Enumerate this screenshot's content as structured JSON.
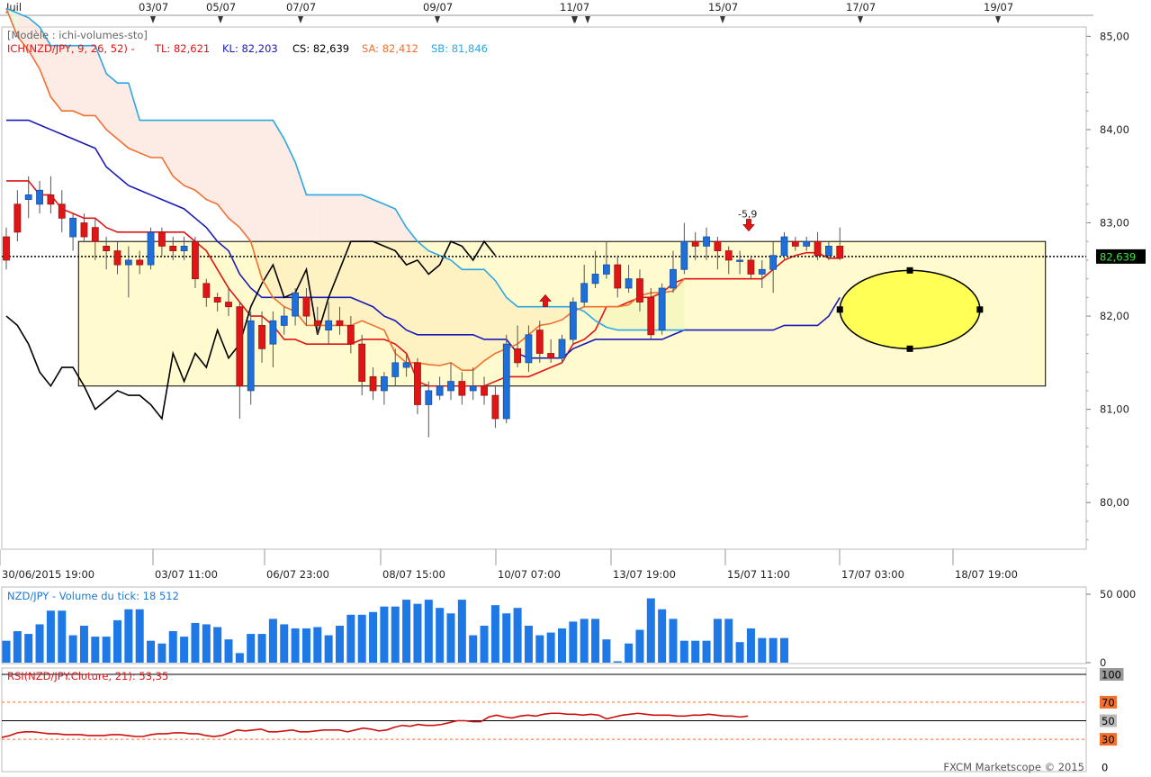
{
  "chart_data": [
    {
      "type": "candlestick",
      "symbol": "NZD/JPY",
      "template_label": "[Modèle : ichi-volumes-sto]",
      "indicator_label": "ICH(NZD/JPY, 9, 26, 52) -",
      "legend": [
        {
          "key": "tl",
          "text": "TL: 82,621",
          "color": "#e01515"
        },
        {
          "key": "kl",
          "text": "KL: 82,203",
          "color": "#1a1ab8"
        },
        {
          "key": "cs",
          "text": "CS: 82,639",
          "color": "#000000"
        },
        {
          "key": "sa",
          "text": "SA: 82,412",
          "color": "#f07030"
        },
        {
          "key": "sb",
          "text": "SB: 81,846",
          "color": "#2aa7e6"
        }
      ],
      "ylim": [
        79.5,
        85.1
      ],
      "y_ticks": [
        "85,00",
        "84,00",
        "83,00",
        "82,00",
        "81,00",
        "80,00"
      ],
      "y_tick_values": [
        85,
        84,
        83,
        82,
        81,
        80
      ],
      "top_dates": [
        "Juil",
        "03/07",
        "05/07",
        "07/07",
        "09/07",
        "11/07",
        "15/07",
        "17/07",
        "19/07"
      ],
      "bottom_dates": [
        "30/06/2015 19:00",
        "03/07 11:00",
        "06/07 23:00",
        "08/07 15:00",
        "10/07 07:00",
        "13/07 19:00",
        "15/07 11:00",
        "17/07 03:00",
        "18/07 19:00"
      ],
      "current_price": 82.639,
      "current_price_label": "82,639",
      "annotation": "-5,9",
      "candles": [
        [
          82.85,
          82.6,
          82.95,
          82.5
        ],
        [
          83.2,
          82.9,
          83.35,
          82.8
        ],
        [
          83.25,
          83.3,
          83.5,
          83.05
        ],
        [
          83.2,
          83.35,
          83.45,
          83.1
        ],
        [
          83.3,
          83.2,
          83.5,
          83.1
        ],
        [
          83.2,
          83.05,
          83.35,
          82.9
        ],
        [
          82.85,
          83.05,
          83.1,
          82.7
        ],
        [
          83.0,
          82.85,
          83.1,
          82.8
        ],
        [
          82.95,
          82.8,
          83.05,
          82.6
        ],
        [
          82.75,
          82.7,
          82.85,
          82.5
        ],
        [
          82.7,
          82.55,
          82.8,
          82.45
        ],
        [
          82.55,
          82.6,
          82.75,
          82.2
        ],
        [
          82.6,
          82.55,
          82.7,
          82.45
        ],
        [
          82.55,
          82.9,
          82.95,
          82.5
        ],
        [
          82.9,
          82.75,
          82.95,
          82.65
        ],
        [
          82.75,
          82.7,
          82.85,
          82.6
        ],
        [
          82.7,
          82.75,
          82.85,
          82.6
        ],
        [
          82.8,
          82.4,
          82.85,
          82.3
        ],
        [
          82.35,
          82.2,
          82.4,
          82.1
        ],
        [
          82.2,
          82.15,
          82.25,
          82.05
        ],
        [
          82.15,
          82.1,
          82.3,
          82.0
        ],
        [
          82.1,
          81.25,
          82.15,
          80.9
        ],
        [
          81.2,
          81.95,
          82.05,
          81.05
        ],
        [
          81.9,
          81.65,
          82.05,
          81.5
        ],
        [
          81.7,
          81.95,
          82.05,
          81.45
        ],
        [
          81.9,
          82.0,
          82.1,
          81.8
        ],
        [
          82.0,
          82.25,
          82.3,
          81.9
        ],
        [
          82.2,
          82.0,
          82.3,
          81.9
        ],
        [
          81.95,
          81.9,
          82.1,
          81.8
        ],
        [
          81.85,
          81.95,
          82.15,
          81.7
        ],
        [
          81.95,
          81.9,
          82.1,
          81.8
        ],
        [
          81.9,
          81.7,
          82.0,
          81.6
        ],
        [
          81.7,
          81.3,
          81.8,
          81.15
        ],
        [
          81.35,
          81.2,
          81.45,
          81.1
        ],
        [
          81.2,
          81.35,
          81.4,
          81.05
        ],
        [
          81.35,
          81.5,
          81.65,
          81.25
        ],
        [
          81.45,
          81.5,
          81.6,
          81.35
        ],
        [
          81.5,
          81.05,
          81.55,
          80.95
        ],
        [
          81.05,
          81.2,
          81.3,
          80.7
        ],
        [
          81.15,
          81.25,
          81.35,
          81.1
        ],
        [
          81.2,
          81.3,
          81.5,
          81.1
        ],
        [
          81.3,
          81.15,
          81.4,
          81.05
        ],
        [
          81.2,
          81.25,
          81.45,
          81.1
        ],
        [
          81.25,
          81.15,
          81.35,
          81.05
        ],
        [
          81.15,
          80.9,
          81.25,
          80.8
        ],
        [
          80.9,
          81.7,
          81.8,
          80.85
        ],
        [
          81.65,
          81.5,
          81.9,
          81.45
        ],
        [
          81.5,
          81.8,
          81.9,
          81.4
        ],
        [
          81.85,
          81.6,
          81.95,
          81.5
        ],
        [
          81.6,
          81.55,
          81.75,
          81.5
        ],
        [
          81.55,
          81.75,
          81.8,
          81.5
        ],
        [
          81.75,
          82.15,
          82.2,
          81.7
        ],
        [
          82.15,
          82.35,
          82.55,
          82.1
        ],
        [
          82.35,
          82.45,
          82.7,
          82.3
        ],
        [
          82.45,
          82.55,
          82.8,
          82.4
        ],
        [
          82.55,
          82.3,
          82.65,
          82.2
        ],
        [
          82.3,
          82.4,
          82.55,
          82.25
        ],
        [
          82.4,
          82.15,
          82.5,
          82.05
        ],
        [
          82.2,
          81.8,
          82.3,
          81.75
        ],
        [
          81.85,
          82.3,
          82.35,
          81.8
        ],
        [
          82.3,
          82.5,
          82.7,
          82.25
        ],
        [
          82.5,
          82.8,
          83.0,
          82.45
        ],
        [
          82.8,
          82.75,
          82.9,
          82.6
        ],
        [
          82.75,
          82.85,
          82.95,
          82.6
        ],
        [
          82.8,
          82.7,
          82.85,
          82.5
        ],
        [
          82.7,
          82.6,
          82.75,
          82.45
        ],
        [
          82.6,
          82.6,
          82.7,
          82.45
        ],
        [
          82.6,
          82.45,
          82.65,
          82.4
        ],
        [
          82.45,
          82.5,
          82.6,
          82.3
        ],
        [
          82.5,
          82.65,
          82.8,
          82.25
        ],
        [
          82.65,
          82.85,
          82.9,
          82.6
        ],
        [
          82.8,
          82.75,
          82.85,
          82.7
        ],
        [
          82.75,
          82.8,
          82.85,
          82.7
        ],
        [
          82.8,
          82.65,
          82.9,
          82.6
        ],
        [
          82.65,
          82.75,
          82.8,
          82.6
        ],
        [
          82.75,
          82.62,
          82.95,
          82.6
        ]
      ],
      "series": [
        {
          "key": "tl",
          "color": "#e01515",
          "values": [
            83.45,
            83.45,
            83.45,
            83.3,
            83.3,
            83.15,
            83.1,
            83.05,
            83.05,
            82.95,
            82.9,
            82.9,
            82.9,
            82.9,
            82.9,
            82.9,
            82.9,
            82.8,
            82.7,
            82.5,
            82.3,
            82.15,
            82.0,
            82.0,
            81.9,
            81.75,
            81.75,
            81.7,
            81.7,
            81.7,
            81.7,
            81.7,
            81.75,
            81.75,
            81.75,
            81.7,
            81.6,
            81.3,
            81.25,
            81.25,
            81.25,
            81.25,
            81.25,
            81.25,
            81.3,
            81.35,
            81.35,
            81.35,
            81.4,
            81.45,
            81.5,
            81.7,
            81.75,
            81.85,
            82.1,
            82.1,
            82.15,
            82.2,
            82.2,
            82.25,
            82.35,
            82.4,
            82.4,
            82.4,
            82.4,
            82.4,
            82.4,
            82.4,
            82.4,
            82.5,
            82.6,
            82.65,
            82.68,
            82.68,
            82.62,
            82.62
          ]
        },
        {
          "key": "kl",
          "color": "#1a1ab8",
          "values": [
            84.1,
            84.1,
            84.1,
            84.05,
            84.0,
            83.95,
            83.9,
            83.85,
            83.8,
            83.6,
            83.5,
            83.4,
            83.35,
            83.3,
            83.25,
            83.2,
            83.15,
            83.05,
            82.95,
            82.8,
            82.7,
            82.45,
            82.3,
            82.2,
            82.2,
            82.2,
            82.2,
            82.2,
            82.2,
            82.2,
            82.2,
            82.2,
            82.15,
            82.1,
            82.0,
            81.95,
            81.85,
            81.8,
            81.8,
            81.8,
            81.8,
            81.8,
            81.8,
            81.75,
            81.75,
            81.75,
            81.6,
            81.55,
            81.55,
            81.55,
            81.55,
            81.65,
            81.7,
            81.75,
            81.75,
            81.75,
            81.75,
            81.75,
            81.75,
            81.75,
            81.8,
            81.85,
            81.85,
            81.85,
            81.85,
            81.85,
            81.85,
            81.85,
            81.85,
            81.85,
            81.9,
            81.9,
            81.9,
            81.9,
            82.0,
            82.2
          ]
        },
        {
          "key": "cs",
          "color": "#000000",
          "values": [
            82.0,
            81.9,
            81.7,
            81.4,
            81.25,
            81.45,
            81.45,
            81.25,
            81.0,
            81.1,
            81.2,
            81.15,
            81.15,
            81.05,
            80.9,
            81.6,
            81.3,
            81.6,
            81.45,
            81.85,
            81.55,
            81.7,
            82.1,
            82.35,
            82.55,
            82.2,
            82.25,
            82.5,
            81.8,
            82.2,
            82.5,
            82.8,
            82.8,
            82.8,
            82.75,
            82.7,
            82.55,
            82.6,
            82.45,
            82.55,
            82.8,
            82.75,
            82.6,
            82.8,
            82.65
          ]
        },
        {
          "key": "sa",
          "color": "#f07030",
          "values": [
            85.3,
            85.0,
            84.85,
            84.65,
            84.35,
            84.2,
            84.2,
            84.15,
            84.15,
            84.0,
            83.9,
            83.8,
            83.75,
            83.7,
            83.7,
            83.5,
            83.4,
            83.35,
            83.25,
            83.2,
            83.05,
            82.95,
            82.8,
            82.4,
            82.2,
            82.1,
            82.05,
            81.9,
            81.9,
            81.9,
            81.9,
            81.9,
            81.95,
            81.9,
            81.85,
            81.6,
            81.5,
            81.5,
            81.48,
            81.47,
            81.5,
            81.42,
            81.42,
            81.52,
            81.6,
            81.65,
            81.7,
            81.8,
            81.9,
            81.92,
            81.96,
            82.05,
            82.1,
            82.1,
            82.1,
            82.1,
            82.12,
            82.22,
            82.25,
            82.25,
            82.27,
            82.4
          ]
        },
        {
          "key": "sb",
          "color": "#2aa7e6",
          "values": [
            85.3,
            85.25,
            85.2,
            85.1,
            84.9,
            84.9,
            84.9,
            84.9,
            84.9,
            84.6,
            84.5,
            84.5,
            84.1,
            84.1,
            84.1,
            84.1,
            84.1,
            84.1,
            84.1,
            84.1,
            84.1,
            84.1,
            84.1,
            84.1,
            84.1,
            83.9,
            83.65,
            83.3,
            83.3,
            83.3,
            83.3,
            83.3,
            83.3,
            83.25,
            83.2,
            83.15,
            82.95,
            82.8,
            82.7,
            82.65,
            82.6,
            82.5,
            82.5,
            82.5,
            82.38,
            82.2,
            82.1,
            82.1,
            82.1,
            82.1,
            82.1,
            82.1,
            82.05,
            81.95,
            81.88,
            81.85,
            81.85,
            81.85,
            81.85,
            81.85,
            81.85,
            81.85
          ]
        }
      ]
    },
    {
      "type": "bar",
      "title": "NZD/JPY - Volume du tick: 18 512",
      "ylim": [
        0,
        50000
      ],
      "y_ticks": [
        "50 000",
        "0"
      ],
      "values": [
        16000,
        23000,
        21000,
        28000,
        38000,
        38000,
        20000,
        27000,
        19000,
        19000,
        31000,
        39000,
        39000,
        16000,
        14000,
        23000,
        19000,
        29000,
        28000,
        26000,
        17000,
        7000,
        21000,
        21000,
        32000,
        28000,
        25000,
        25000,
        26000,
        20000,
        27000,
        35000,
        35000,
        37000,
        41000,
        41000,
        46000,
        43000,
        46000,
        40000,
        36000,
        46000,
        20000,
        27000,
        42000,
        36000,
        40000,
        27000,
        20000,
        22000,
        25000,
        30000,
        32000,
        32000,
        17000,
        1000,
        14000,
        24000,
        47000,
        39000,
        32000,
        16000,
        16000,
        16000,
        32000,
        32000,
        15000,
        25000,
        18000,
        18000,
        18000
      ]
    },
    {
      "type": "line",
      "title": "RSI(NZD/JPY.Cloture, 21): 53,35",
      "ylim": [
        0,
        100
      ],
      "y_ticks": [
        "100",
        "70",
        "50",
        "30",
        "0"
      ],
      "levels": [
        100,
        70,
        50,
        30
      ],
      "values": [
        32,
        34,
        37,
        38,
        38,
        37,
        36,
        36,
        35,
        35,
        35,
        34,
        34,
        34,
        35,
        35,
        34,
        33,
        33,
        35,
        36,
        36,
        37,
        37,
        36,
        36,
        34,
        33,
        34,
        37,
        40,
        39,
        40,
        41,
        38,
        38,
        39,
        40,
        38,
        38,
        39,
        40,
        40,
        40,
        38,
        40,
        42,
        41,
        39,
        40,
        43,
        45,
        44,
        46,
        45,
        45,
        46,
        48,
        50,
        50,
        49,
        49,
        54,
        56,
        54,
        53,
        55,
        56,
        55,
        57,
        58,
        58,
        57,
        57,
        56,
        57,
        56,
        52,
        54,
        56,
        57,
        58,
        57,
        56,
        56,
        56,
        55,
        55,
        56,
        56,
        57,
        56,
        55,
        55,
        54,
        55
      ]
    }
  ],
  "footer": {
    "copyright": "FXCM Marketscope © 2015"
  }
}
